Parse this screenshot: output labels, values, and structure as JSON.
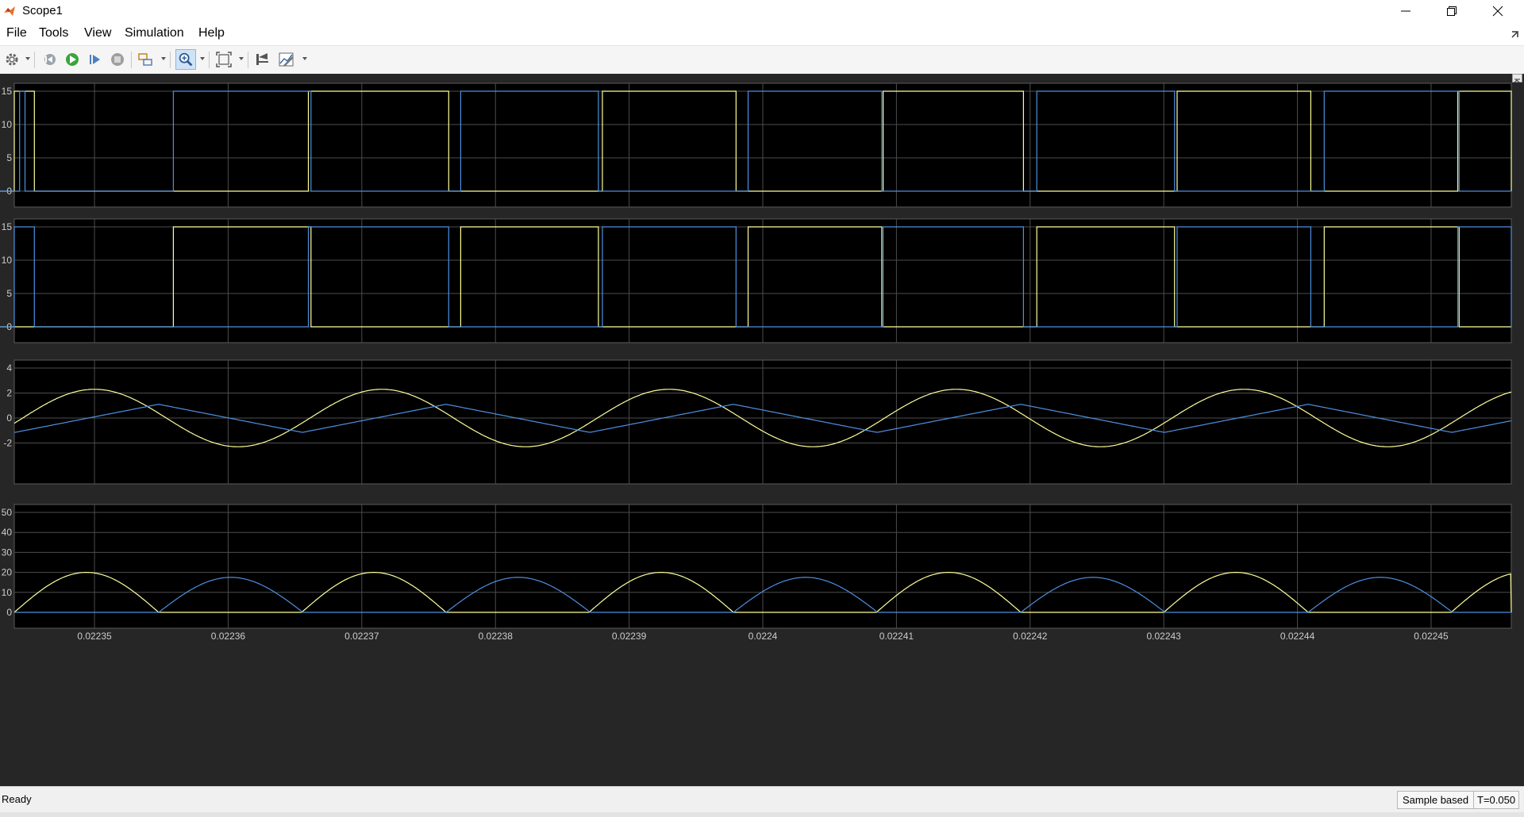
{
  "window": {
    "title": "Scope1",
    "app_icon": "matlab-logo-icon"
  },
  "menu": {
    "file": "File",
    "tools": "Tools",
    "view": "View",
    "simulation": "Simulation",
    "help": "Help"
  },
  "toolbar": {
    "icons": [
      "gear-icon",
      "step-back-icon",
      "run-icon",
      "step-forward-icon",
      "stop-icon",
      "signal-select-icon",
      "zoom-in-icon",
      "fit-to-view-icon",
      "cursor-measure-icon",
      "style-icon"
    ],
    "active_tool": "zoom-in-icon"
  },
  "status": {
    "text": "Ready",
    "sample_mode": "Sample based",
    "time": "T=0.050"
  },
  "colors": {
    "background": "#000000",
    "figure": "#262626",
    "grid": "#4d4d4d",
    "series_yellow": "#ffff99",
    "series_blue": "#4d90e0",
    "tick": "#cccccc"
  },
  "chart_data": [
    {
      "type": "line",
      "subplot": 1,
      "x_range": [
        0.022344,
        0.022456
      ],
      "ylim": [
        0,
        15
      ],
      "yticks": [
        "0",
        "5",
        "10",
        "15"
      ],
      "series": [
        {
          "color": "yellow",
          "kind": "pulse",
          "high": 15,
          "low": 0,
          "high_intervals": [
            [
              0.022344,
              0.0223455
            ],
            [
              0.022366,
              0.0223765
            ],
            [
              0.022388,
              0.022398
            ],
            [
              0.022409,
              0.0224195
            ],
            [
              0.022431,
              0.022441
            ],
            [
              0.022452,
              0.022456
            ]
          ]
        },
        {
          "color": "blue",
          "kind": "pulse",
          "high": 15,
          "low": 0,
          "high_intervals": [
            [
              0.0223444,
              0.0223448
            ],
            [
              0.0223559,
              0.0223662
            ],
            [
              0.0223774,
              0.0223877
            ],
            [
              0.0223989,
              0.0224089
            ],
            [
              0.0224205,
              0.0224308
            ],
            [
              0.022442,
              0.0224521
            ]
          ]
        }
      ]
    },
    {
      "type": "line",
      "subplot": 2,
      "x_range": [
        0.022344,
        0.022456
      ],
      "ylim": [
        0,
        15
      ],
      "yticks": [
        "0",
        "5",
        "10",
        "15"
      ],
      "series": [
        {
          "color": "yellow",
          "kind": "pulse",
          "high": 15,
          "low": 0,
          "high_intervals": [
            [
              0.0223559,
              0.0223662
            ],
            [
              0.0223774,
              0.0223877
            ],
            [
              0.0223989,
              0.0224089
            ],
            [
              0.0224205,
              0.0224308
            ],
            [
              0.022442,
              0.0224521
            ]
          ]
        },
        {
          "color": "blue",
          "kind": "pulse",
          "high": 15,
          "low": 0,
          "high_intervals": [
            [
              0.022344,
              0.0223455
            ],
            [
              0.022366,
              0.0223765
            ],
            [
              0.022388,
              0.022398
            ],
            [
              0.022409,
              0.0224195
            ],
            [
              0.022431,
              0.022441
            ],
            [
              0.022452,
              0.022456
            ]
          ]
        }
      ]
    },
    {
      "type": "line",
      "subplot": 3,
      "x_range": [
        0.022344,
        0.022456
      ],
      "ylim": [
        -4,
        4
      ],
      "yticks": [
        "-2",
        "0",
        "2",
        "4"
      ],
      "series": [
        {
          "color": "yellow",
          "kind": "sine",
          "amplitude": 2.3,
          "period": 2.15e-05,
          "peak_at": 0.02235
        },
        {
          "color": "blue",
          "kind": "triangle",
          "min": -1.15,
          "max": 1.1,
          "first_peak_at": 0.0223548,
          "period": 2.15e-05
        }
      ]
    },
    {
      "type": "line",
      "subplot": 4,
      "x_range": [
        0.022344,
        0.022456
      ],
      "ylim": [
        0,
        50
      ],
      "yticks": [
        "0",
        "10",
        "20",
        "30",
        "40",
        "50"
      ],
      "series": [
        {
          "color": "yellow",
          "kind": "arches",
          "peak": 20,
          "arches": [
            [
              0.022344,
              0.0223548
            ],
            [
              0.0223655,
              0.0223763
            ],
            [
              0.022387,
              0.0223978
            ],
            [
              0.0224085,
              0.0224193
            ],
            [
              0.02243,
              0.0224408
            ],
            [
              0.0224515,
              0.022456
            ]
          ]
        },
        {
          "color": "blue",
          "kind": "arches",
          "peak": 17.5,
          "arches": [
            [
              0.0223548,
              0.0223655
            ],
            [
              0.0223763,
              0.022387
            ],
            [
              0.0223978,
              0.0224085
            ],
            [
              0.0224193,
              0.02243
            ],
            [
              0.0224408,
              0.0224515
            ]
          ]
        }
      ]
    }
  ],
  "x_axis": {
    "ticks": [
      "0.02235",
      "0.02236",
      "0.02237",
      "0.02238",
      "0.02239",
      "0.0224",
      "0.02241",
      "0.02242",
      "0.02243",
      "0.02244",
      "0.02245"
    ]
  }
}
